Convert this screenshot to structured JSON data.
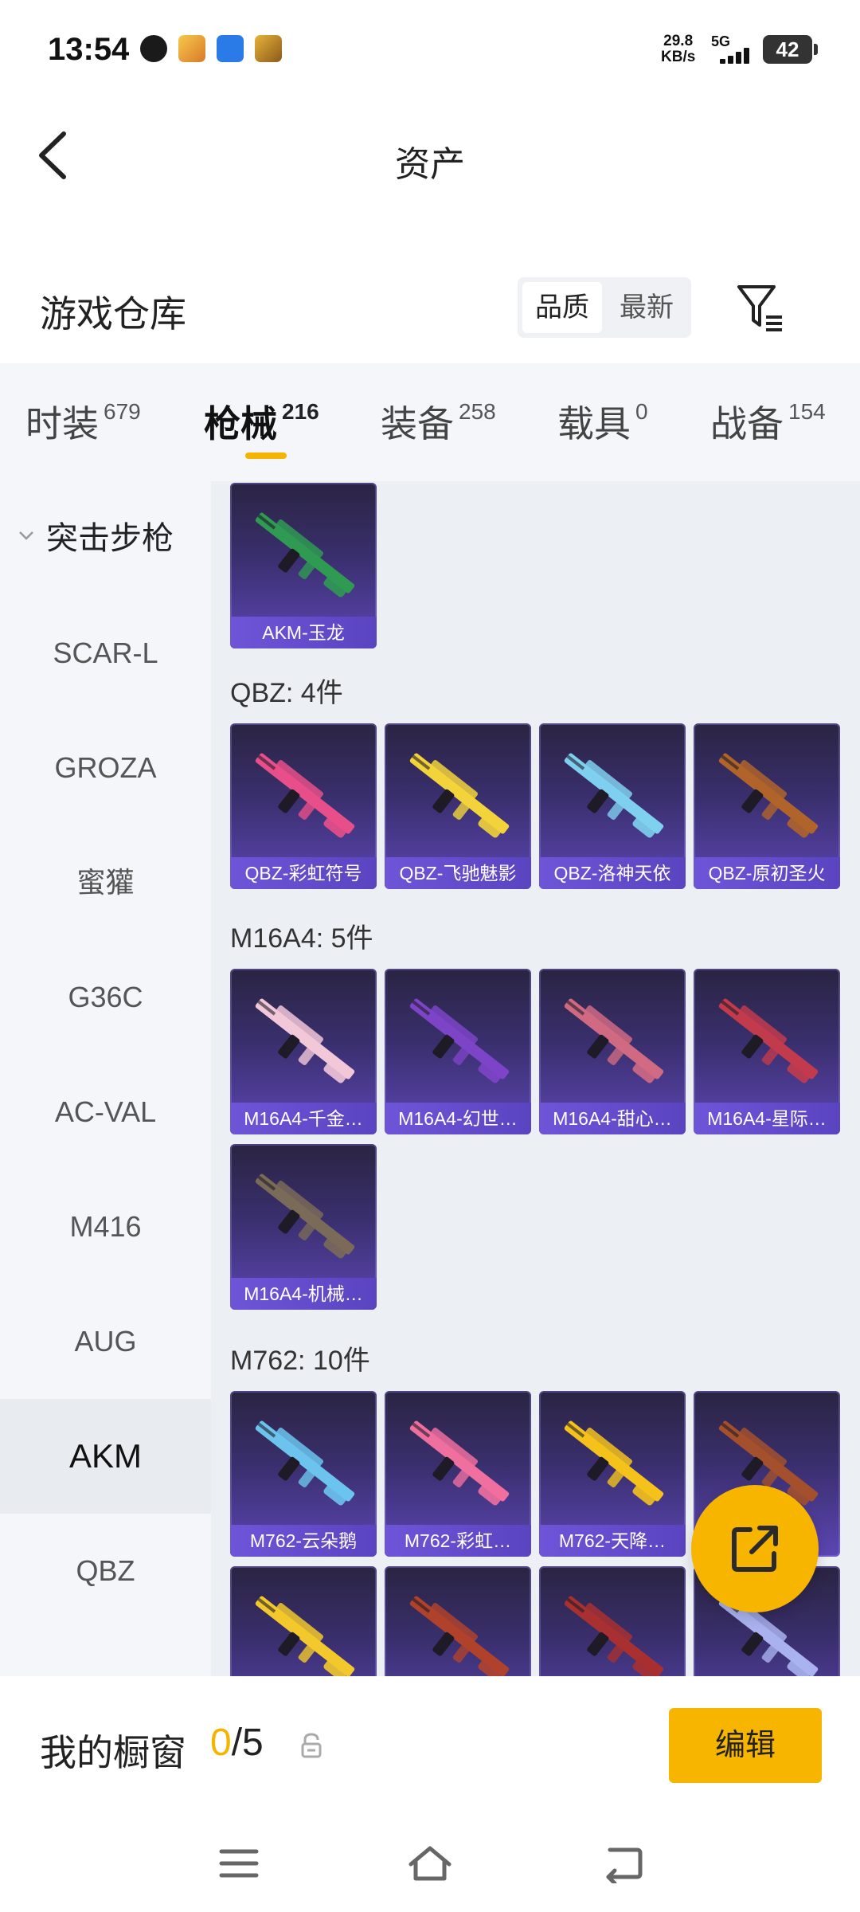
{
  "status_bar": {
    "time": "13:54",
    "speed_value": "29.8",
    "speed_unit": "KB/s",
    "network": "5G",
    "battery": "42"
  },
  "header": {
    "title": "资产",
    "back_icon": "chevron-left-icon"
  },
  "warehouse": {
    "title": "游戏仓库",
    "sort_options": [
      "品质",
      "最新"
    ],
    "selected_sort": "品质",
    "filter_icon": "filter-icon"
  },
  "tabs": [
    {
      "label": "时装",
      "count": "679"
    },
    {
      "label": "枪械",
      "count": "216"
    },
    {
      "label": "装备",
      "count": "258"
    },
    {
      "label": "载具",
      "count": "0"
    },
    {
      "label": "战备",
      "count": "154"
    }
  ],
  "active_tab": "枪械",
  "sidebar": {
    "category": "突击步枪",
    "items": [
      "SCAR-L",
      "GROZA",
      "蜜獾",
      "G36C",
      "AC-VAL",
      "M416",
      "AUG",
      "AKM",
      "QBZ"
    ],
    "active_item": "AKM"
  },
  "groups": [
    {
      "title": "",
      "items": [
        {
          "label": "AKM-玉龙",
          "color": "#2f9a52"
        }
      ]
    },
    {
      "title": "QBZ: 4件",
      "items": [
        {
          "label": "QBZ-彩虹符号",
          "color": "#e84f8a"
        },
        {
          "label": "QBZ-飞驰魅影",
          "color": "#f3d33a"
        },
        {
          "label": "QBZ-洛神天依",
          "color": "#7fd0f0"
        },
        {
          "label": "QBZ-原初圣火",
          "color": "#b0642a"
        }
      ]
    },
    {
      "title": "M16A4: 5件",
      "items": [
        {
          "label": "M16A4-千金…",
          "color": "#f2c7d8"
        },
        {
          "label": "M16A4-幻世…",
          "color": "#7d44c8"
        },
        {
          "label": "M16A4-甜心…",
          "color": "#d06a82"
        },
        {
          "label": "M16A4-星际…",
          "color": "#c23b4c"
        },
        {
          "label": "M16A4-机械…",
          "color": "#7a6a58"
        }
      ]
    },
    {
      "title": "M762: 10件",
      "items": [
        {
          "label": "M762-云朵鹅",
          "color": "#6cc4ee"
        },
        {
          "label": "M762-彩虹…",
          "color": "#ef6f9e"
        },
        {
          "label": "M762-天降…",
          "color": "#f5c21c"
        },
        {
          "label": "",
          "color": "#a5502c"
        },
        {
          "label": "",
          "color": "#f2c82c"
        },
        {
          "label": "",
          "color": "#b0422c"
        },
        {
          "label": "",
          "color": "#a83030"
        },
        {
          "label": "",
          "color": "#a9b2ee"
        }
      ]
    }
  ],
  "fab": {
    "icon": "share-icon"
  },
  "showcase": {
    "label": "我的橱窗",
    "current": "0",
    "total": "/5",
    "edit_label": "编辑"
  },
  "nav": [
    "menu-icon",
    "home-icon",
    "back-icon"
  ]
}
